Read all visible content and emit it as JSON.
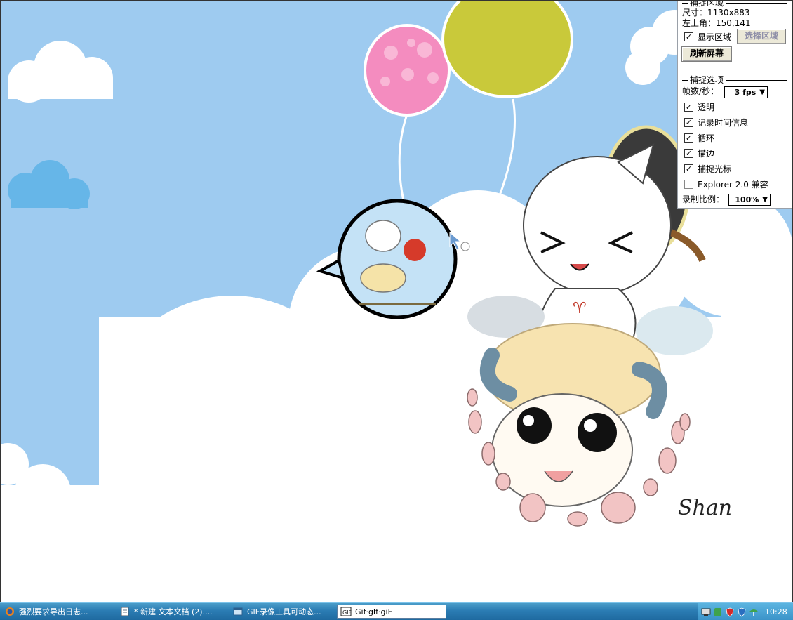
{
  "panel": {
    "capture_area": {
      "title": "捕捉区域",
      "size_text": "尺寸：1130x883",
      "topleft_text": "左上角：150,141",
      "show_area_label": "显示区域",
      "show_area_checked": true,
      "select_area_button": "选择区域",
      "refresh_button": "刷新屏幕"
    },
    "capture_options": {
      "title": "捕捉选项",
      "fps_label": "帧数/秒：",
      "fps_value": "3 fps",
      "options": [
        {
          "label": "透明",
          "checked": true
        },
        {
          "label": "记录时间信息",
          "checked": true
        },
        {
          "label": "循环",
          "checked": true
        },
        {
          "label": "描边",
          "checked": true
        },
        {
          "label": "捕捉光标",
          "checked": true
        },
        {
          "label": "Explorer 2.0 兼容",
          "checked": false
        }
      ],
      "scale_label": "录制比例：",
      "scale_value": "100%"
    }
  },
  "taskbar": {
    "tasks": [
      {
        "label": "强烈要求导出日志...",
        "icon": "firefox-icon",
        "active": false
      },
      {
        "label": "* 新建 文本文档 (2)....",
        "icon": "notepad-icon",
        "active": false
      },
      {
        "label": "GIF录像工具可动态...",
        "icon": "browser-icon",
        "active": false
      },
      {
        "label": "Gif·gIf·giF",
        "icon": "gif-recorder-icon",
        "active": true
      }
    ],
    "tray_icons": [
      "display-icon",
      "shield-green-icon",
      "shield-red-icon",
      "security-icon",
      "network-icon"
    ],
    "clock": "10:28"
  },
  "wallpaper": {
    "signature": "Shan",
    "sky_color": "#9ecbf0",
    "balloon_pink": "#f48cbf",
    "balloon_yellow": "#c9c93a",
    "ram_symbol": "♈"
  }
}
